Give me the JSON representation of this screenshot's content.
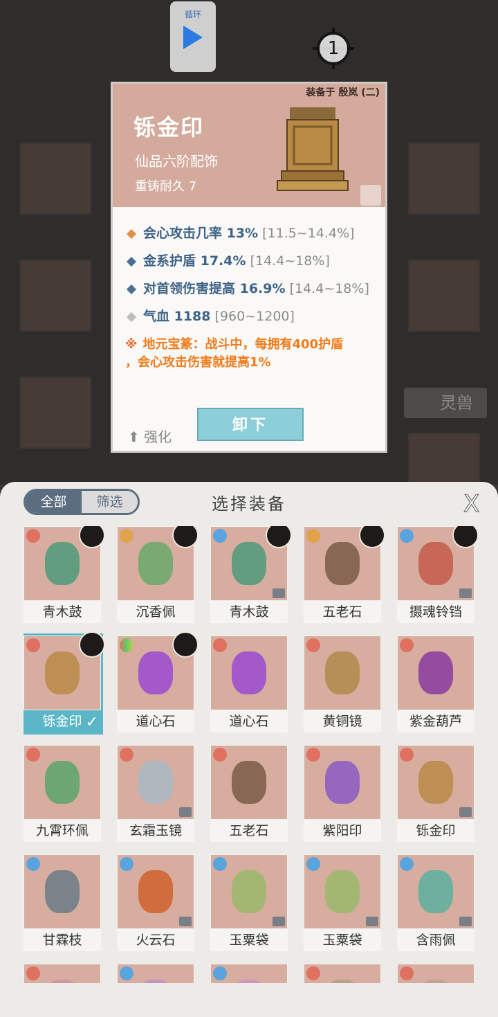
{
  "top": {
    "loop_label": "循环",
    "target_count": "1",
    "lingshou_label": "灵兽"
  },
  "detail": {
    "equipped_on": "装备于 殷岚 (二)",
    "name": "铄金印",
    "grade": "仙品六阶配饰",
    "recast": "重铸耐久 7",
    "stats": [
      {
        "name": "会心攻击几率 13%",
        "range": "[11.5~14.4%]",
        "color": "#e0904a"
      },
      {
        "name": "金系护盾 17.4%",
        "range": "[14.4~18%]",
        "color": "#4e6f94"
      },
      {
        "name": "对首领伤害提高 16.9%",
        "range": "[14.4~18%]",
        "color": "#4e6f94"
      },
      {
        "name": "气血 1188",
        "range": "[960~1200]",
        "color": "#bcbcbc"
      }
    ],
    "special_line1": "地元宝篆：战斗中，每拥有400护盾",
    "special_line2": "，会心攻击伤害就提高1%",
    "strengthen_label": "强化",
    "unequip_label": "卸下"
  },
  "panel": {
    "tabs": [
      "全部",
      "筛选"
    ],
    "title": "选择装备",
    "close": "X",
    "items": [
      {
        "name": "青木鼓",
        "elem": "red",
        "owner": true,
        "tag": false,
        "selected": false
      },
      {
        "name": "沉香佩",
        "elem": "orange",
        "owner": true,
        "tag": false,
        "selected": false
      },
      {
        "name": "青木鼓",
        "elem": "blue",
        "owner": true,
        "tag": true,
        "selected": false
      },
      {
        "name": "五老石",
        "elem": "orange",
        "owner": true,
        "tag": false,
        "selected": false
      },
      {
        "name": "摄魂铃铛",
        "elem": "blue",
        "owner": true,
        "tag": true,
        "selected": false
      },
      {
        "name": "铄金印",
        "elem": "red",
        "owner": true,
        "tag": false,
        "selected": true
      },
      {
        "name": "道心石",
        "elem": "multi",
        "owner": true,
        "tag": false,
        "selected": false
      },
      {
        "name": "道心石",
        "elem": "red",
        "owner": false,
        "tag": false,
        "selected": false
      },
      {
        "name": "黄铜镜",
        "elem": "red",
        "owner": false,
        "tag": false,
        "selected": false
      },
      {
        "name": "紫金葫芦",
        "elem": "red",
        "owner": false,
        "tag": false,
        "selected": false
      },
      {
        "name": "九霄环佩",
        "elem": "red",
        "owner": false,
        "tag": false,
        "selected": false
      },
      {
        "name": "玄霜玉镜",
        "elem": "red",
        "owner": false,
        "tag": true,
        "selected": false
      },
      {
        "name": "五老石",
        "elem": "red",
        "owner": false,
        "tag": false,
        "selected": false
      },
      {
        "name": "紫阳印",
        "elem": "red",
        "owner": false,
        "tag": false,
        "selected": false
      },
      {
        "name": "铄金印",
        "elem": "red",
        "owner": false,
        "tag": true,
        "selected": false
      },
      {
        "name": "甘霖枝",
        "elem": "blue",
        "owner": false,
        "tag": false,
        "selected": false
      },
      {
        "name": "火云石",
        "elem": "blue",
        "owner": false,
        "tag": true,
        "selected": false
      },
      {
        "name": "玉粟袋",
        "elem": "blue",
        "owner": false,
        "tag": true,
        "selected": false
      },
      {
        "name": "玉粟袋",
        "elem": "blue",
        "owner": false,
        "tag": true,
        "selected": false
      },
      {
        "name": "含雨佩",
        "elem": "blue",
        "owner": false,
        "tag": true,
        "selected": false
      },
      {
        "name": "",
        "elem": "red",
        "owner": false,
        "tag": false,
        "selected": false
      },
      {
        "name": "",
        "elem": "blue",
        "owner": false,
        "tag": false,
        "selected": false
      },
      {
        "name": "",
        "elem": "blue",
        "owner": false,
        "tag": false,
        "selected": false
      },
      {
        "name": "",
        "elem": "red",
        "owner": false,
        "tag": false,
        "selected": false
      },
      {
        "name": "",
        "elem": "red",
        "owner": false,
        "tag": false,
        "selected": false
      }
    ]
  }
}
